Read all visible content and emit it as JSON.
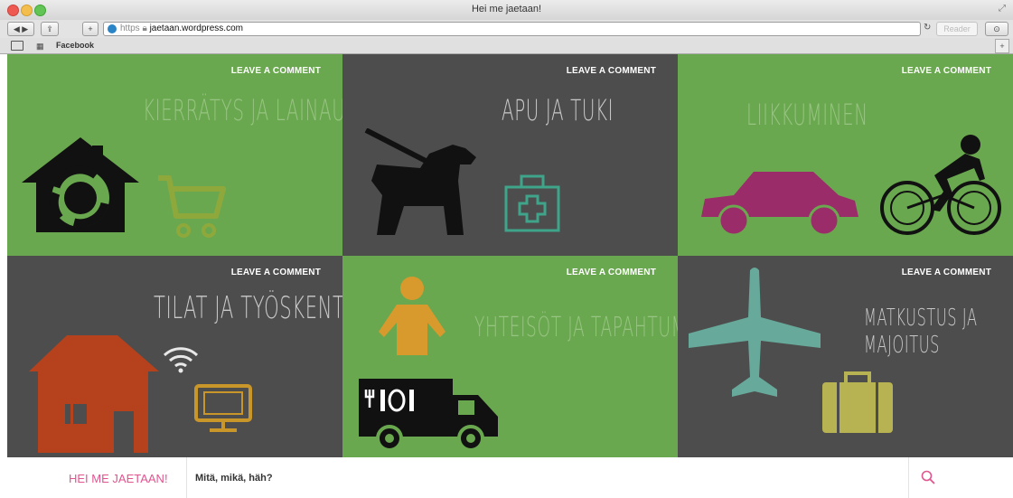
{
  "browser": {
    "window_title": "Hei me jaetaan!",
    "url_protocol": "https",
    "url_host": "jaetaan.wordpress.com",
    "reader_label": "Reader",
    "bookmark_label": "Facebook"
  },
  "tiles": [
    {
      "title": "KIERRÄTYS JA LAINAUS",
      "action": "LEAVE A COMMENT",
      "theme": "green"
    },
    {
      "title": "APU JA TUKI",
      "action": "LEAVE A COMMENT",
      "theme": "gray"
    },
    {
      "title": "LIIKKUMINEN",
      "action": "LEAVE A COMMENT",
      "theme": "green"
    },
    {
      "title": "TILAT JA TYÖSKENTELY",
      "action": "LEAVE A COMMENT",
      "theme": "gray"
    },
    {
      "title": "YHTEISÖT JA TAPAHTUMAT",
      "action": "LEAVE A COMMENT",
      "theme": "green"
    },
    {
      "title_line1": "MATKUSTUS JA",
      "title_line2": "MAJOITUS",
      "action": "LEAVE A COMMENT",
      "theme": "gray"
    }
  ],
  "footer": {
    "site_name": "HEI ME JAETAAN!",
    "search_placeholder": "Mitä, mikä, häh?"
  },
  "colors": {
    "green": "#6aa84f",
    "gray": "#4d4d4d",
    "accent_pink": "#e0558f"
  }
}
